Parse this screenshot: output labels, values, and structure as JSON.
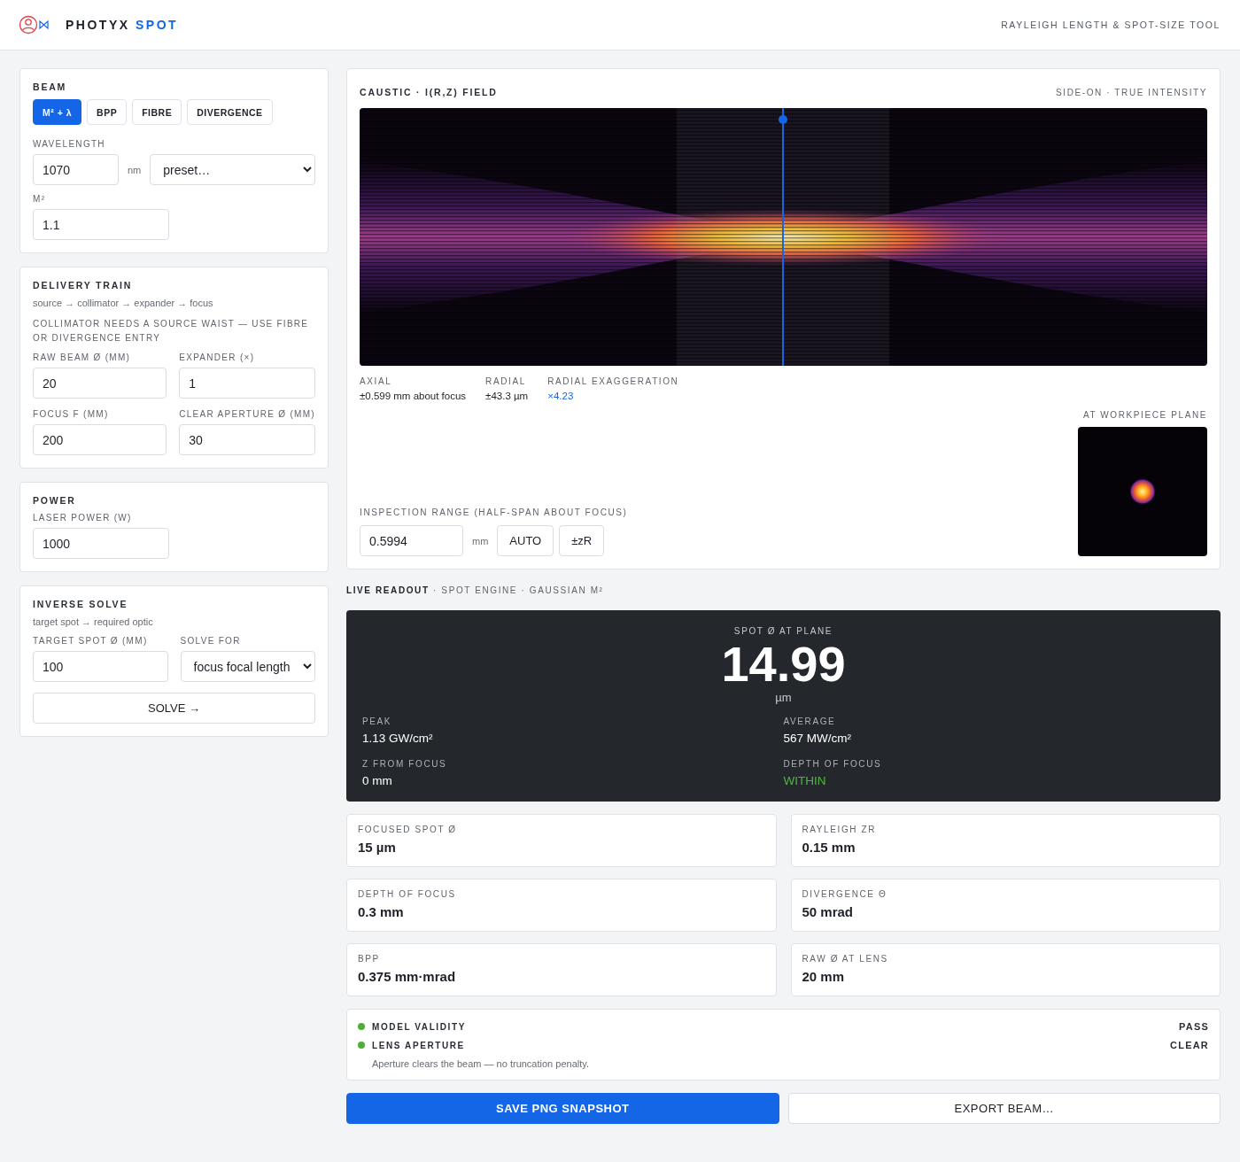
{
  "header": {
    "brand": "PHOTYX",
    "brand_accent": "SPOT",
    "tagline": "RAYLEIGH LENGTH & SPOT-SIZE TOOL"
  },
  "beam": {
    "title": "BEAM",
    "modes": [
      {
        "label": "M² + λ",
        "selected": true
      },
      {
        "label": "BPP",
        "selected": false
      },
      {
        "label": "FIBRE",
        "selected": false
      },
      {
        "label": "DIVERGENCE",
        "selected": false
      }
    ],
    "wavelength_label": "WAVELENGTH",
    "wavelength": "1070",
    "wavelength_unit": "nm",
    "preset": "preset…",
    "m2_label": "M²",
    "m2": "1.1"
  },
  "delivery": {
    "title": "DELIVERY TRAIN",
    "subtitle": "source → collimator → expander → focus",
    "warning": "COLLIMATOR NEEDS A SOURCE WAIST — USE FIBRE OR DIVERGENCE ENTRY",
    "fields": [
      {
        "label": "RAW BEAM Ø (MM)",
        "value": "20"
      },
      {
        "label": "EXPANDER (×)",
        "value": "1"
      },
      {
        "label": "FOCUS F (MM)",
        "value": "200"
      },
      {
        "label": "CLEAR APERTURE Ø (MM)",
        "value": "30"
      }
    ]
  },
  "power": {
    "title": "POWER",
    "label": "LASER POWER (W)",
    "value": "1000"
  },
  "inverse": {
    "title": "INVERSE SOLVE",
    "subtitle": "target spot → required optic",
    "target_label": "TARGET SPOT Ø (MM)",
    "target": "100",
    "solve_for_label": "SOLVE FOR",
    "solve_for": "focus focal length",
    "button": "SOLVE →"
  },
  "caustic": {
    "title": "CAUSTIC · I(R,Z) FIELD",
    "mode": "SIDE-ON · TRUE INTENSITY",
    "stats": [
      {
        "label": "AXIAL",
        "value": "±0.599 mm about focus",
        "accent": false
      },
      {
        "label": "RADIAL",
        "value": "±43.3 µm",
        "accent": false
      },
      {
        "label": "RADIAL EXAGGERATION",
        "value": "×4.23",
        "accent": true
      }
    ],
    "plane_label": "AT WORKPIECE PLANE",
    "range_label": "INSPECTION RANGE (HALF-SPAN ABOUT FOCUS)",
    "range": "0.5994",
    "range_unit": "mm",
    "range_buttons": [
      "AUTO",
      "±zR"
    ]
  },
  "readout_heading": {
    "title": "LIVE READOUT",
    "detail": "· SPOT ENGINE · GAUSSIAN M²"
  },
  "readout": {
    "label": "SPOT Ø AT PLANE",
    "value": "14.99",
    "unit": "µm",
    "items": [
      {
        "label": "PEAK",
        "value": "1.13 GW/cm²"
      },
      {
        "label": "AVERAGE",
        "value": "567 MW/cm²"
      },
      {
        "label": "Z FROM FOCUS",
        "value": "0 mm"
      },
      {
        "label": "DEPTH OF FOCUS",
        "value": "WITHIN",
        "color": "#4cbb3a"
      }
    ]
  },
  "metrics": [
    {
      "label": "FOCUSED SPOT Ø",
      "value": "15 µm"
    },
    {
      "label": "RAYLEIGH ZR",
      "value": "0.15 mm"
    },
    {
      "label": "DEPTH OF FOCUS",
      "value": "0.3 mm"
    },
    {
      "label": "DIVERGENCE Θ",
      "value": "50 mrad"
    },
    {
      "label": "BPP",
      "value": "0.375 mm·mrad"
    },
    {
      "label": "RAW Ø AT LENS",
      "value": "20 mm"
    }
  ],
  "checks": {
    "items": [
      {
        "label": "MODEL VALIDITY",
        "state": "PASS",
        "color": "#4caf38"
      },
      {
        "label": "LENS APERTURE",
        "state": "CLEAR",
        "color": "#4caf38"
      }
    ],
    "note": "Aperture clears the beam — no truncation penalty."
  },
  "actions": [
    {
      "label": "SAVE PNG SNAPSHOT",
      "primary": true
    },
    {
      "label": "EXPORT BEAM…",
      "primary": false
    }
  ]
}
